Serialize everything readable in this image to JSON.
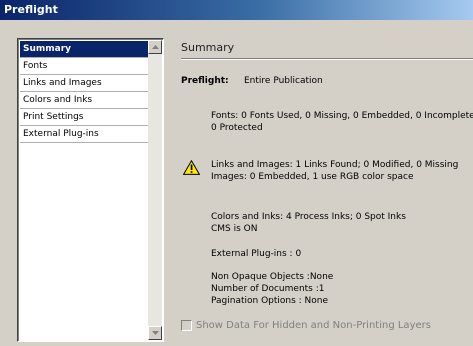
{
  "window": {
    "title": "Preflight"
  },
  "sidebar": {
    "items": [
      {
        "label": "Summary",
        "selected": true
      },
      {
        "label": "Fonts"
      },
      {
        "label": "Links and Images"
      },
      {
        "label": "Colors and Inks"
      },
      {
        "label": "Print Settings"
      },
      {
        "label": "External Plug-ins"
      }
    ]
  },
  "main": {
    "section_title": "Summary",
    "preflight_label": "Preflight:",
    "preflight_value": "Entire Publication",
    "fonts_line1": "Fonts: 0 Fonts Used, 0 Missing, 0 Embedded, 0 Incomplete",
    "fonts_line2": "0 Protected",
    "links_line1": "Links and Images: 1 Links Found; 0 Modified, 0 Missing",
    "links_line2": "Images: 0 Embedded, 1 use RGB color space",
    "colors_line1": "Colors and Inks: 4 Process Inks; 0 Spot Inks",
    "colors_line2": "CMS is ON",
    "plugins_line": "External Plug-ins : 0",
    "nonopaque_line": "Non Opaque Objects :None",
    "documents_line": "Number of Documents :1",
    "pagination_line": "Pagination Options : None",
    "show_hidden_label": "Show Data For Hidden and Non-Printing Layers",
    "show_hidden_checked": false
  },
  "icons": {
    "warning": "warning-icon",
    "scroll_up": "scroll-up-arrow-icon",
    "scroll_down": "scroll-down-arrow-icon"
  },
  "colors": {
    "selection": "#0a246a",
    "window_bg": "#d4d0c8",
    "warning_fill": "#ffe800"
  }
}
